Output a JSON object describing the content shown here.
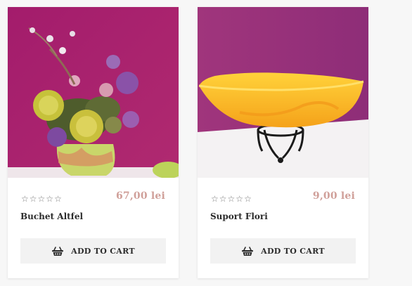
{
  "products": [
    {
      "name": "Buchet Altfel",
      "price": "67,00 lei",
      "rating_stars_filled": 0,
      "rating_stars_total": 5,
      "image_icon": "flower-vase-image",
      "add_to_cart_label": "ADD TO CART",
      "cart_icon": "basket-icon"
    },
    {
      "name": "Suport Flori",
      "price": "9,00 lei",
      "rating_stars_filled": 0,
      "rating_stars_total": 5,
      "image_icon": "orange-bowl-stand-image",
      "add_to_cart_label": "ADD TO CART",
      "cart_icon": "basket-icon"
    }
  ],
  "colors": {
    "price": "#d0a09a",
    "button_bg": "#f2f2f2",
    "text": "#2b2b2b"
  }
}
